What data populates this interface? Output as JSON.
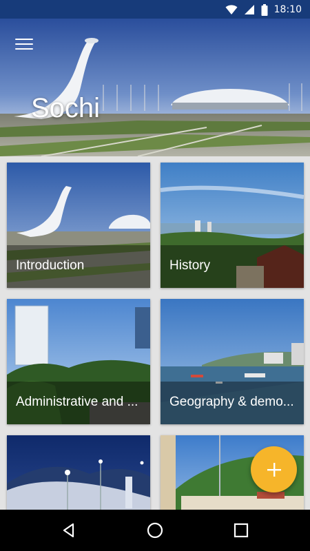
{
  "status_bar": {
    "time": "18:10",
    "background": "#173b7a",
    "icons": [
      "wifi-icon",
      "signal-icon",
      "battery-icon"
    ]
  },
  "header": {
    "title": "Sochi",
    "menu_icon": "hamburger-menu-icon"
  },
  "cards": [
    {
      "label": "Introduction"
    },
    {
      "label": "History"
    },
    {
      "label": "Administrative and ..."
    },
    {
      "label": "Geography & demo..."
    },
    {
      "label": ""
    },
    {
      "label": ""
    }
  ],
  "fab": {
    "icon": "plus-icon",
    "color": "#f6b52a"
  },
  "nav_bar": {
    "icons": [
      "back-icon",
      "home-icon",
      "recents-icon"
    ]
  }
}
